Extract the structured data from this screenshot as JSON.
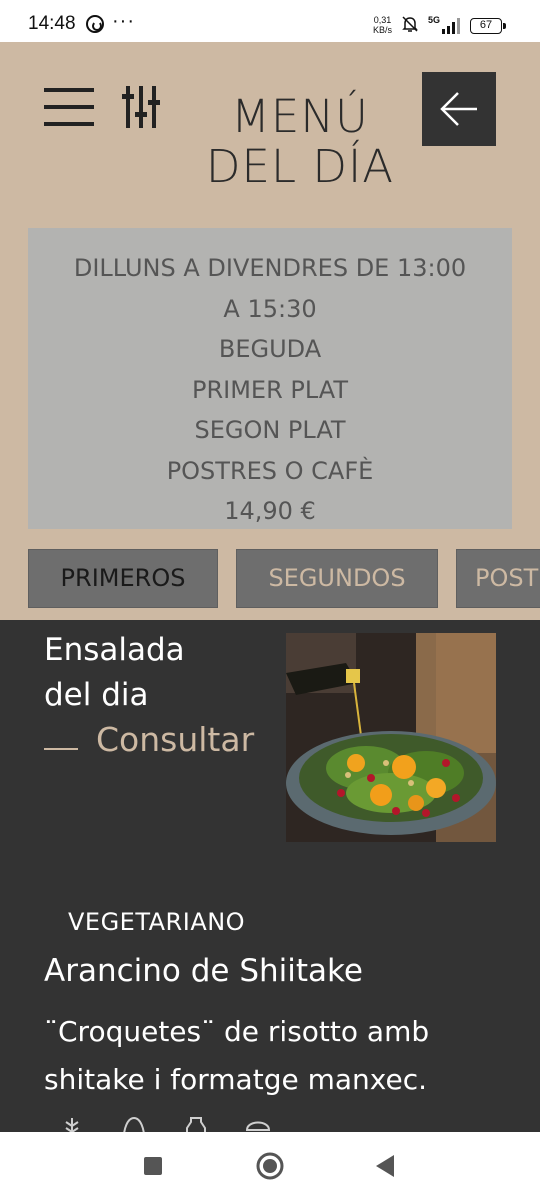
{
  "status_bar": {
    "time": "14:48",
    "more": "···",
    "speed_value": "0,31",
    "speed_unit": "KB/s",
    "network": "5G",
    "battery": "67"
  },
  "header": {
    "title_line1": "MENÚ",
    "title_line2": "DEL DÍA"
  },
  "info": {
    "lines": [
      "DILLUNS A DIVENDRES DE 13:00",
      "A 15:30",
      "BEGUDA",
      "PRIMER PLAT",
      "SEGON PLAT",
      "POSTRES O CAFÈ",
      "14,90 €"
    ]
  },
  "tabs": [
    {
      "label": "PRIMEROS",
      "active": true
    },
    {
      "label": "SEGUNDOS",
      "active": false
    },
    {
      "label": "POSTRES",
      "active": false
    }
  ],
  "dishes": [
    {
      "name_line1": "Ensalada",
      "name_line2": "del dia",
      "price": "Consultar",
      "image_icon": "salad-photo"
    },
    {
      "tag": "VEGETARIANO",
      "name": "Arancino de Shiitake",
      "desc_line1": "¨Croquetes¨ de risotto amb",
      "desc_line2": "shitake i formatge manxec.",
      "allergen_icons": [
        "gluten-icon",
        "egg-icon",
        "milk-icon",
        "mushroom-icon"
      ]
    }
  ],
  "colors": {
    "header_bg": "#cdb9a3",
    "content_bg": "#333333",
    "info_bg": "#b3b3b1",
    "accent": "#cdb9a3"
  }
}
